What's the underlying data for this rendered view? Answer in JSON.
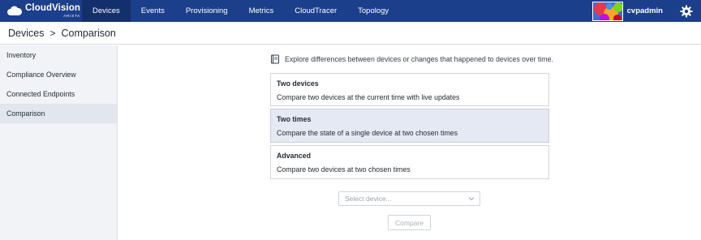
{
  "app": {
    "logo_title": "CloudVision",
    "logo_sub": "ARISTA"
  },
  "nav": {
    "tabs": [
      {
        "label": "Devices",
        "active": true
      },
      {
        "label": "Events",
        "active": false
      },
      {
        "label": "Provisioning",
        "active": false
      },
      {
        "label": "Metrics",
        "active": false
      },
      {
        "label": "CloudTracer",
        "active": false
      },
      {
        "label": "Topology",
        "active": false
      }
    ],
    "username": "cvpadmin",
    "settings_icon": "gear-icon"
  },
  "breadcrumb": {
    "parent": "Devices",
    "separator": ">",
    "current": "Comparison"
  },
  "sidebar": {
    "items": [
      {
        "label": "Inventory",
        "active": false
      },
      {
        "label": "Compliance Overview",
        "active": false
      },
      {
        "label": "Connected Endpoints",
        "active": false
      },
      {
        "label": "Comparison",
        "active": true
      }
    ]
  },
  "main": {
    "intro": "Explore differences between devices or changes that happened to devices over time.",
    "intro_icon": "book-icon",
    "options": [
      {
        "title": "Two devices",
        "description": "Compare two devices at the current time with live updates",
        "selected": false
      },
      {
        "title": "Two times",
        "description": "Compare the state of a single device at two chosen times",
        "selected": true
      },
      {
        "title": "Advanced",
        "description": "Compare two devices at two chosen times",
        "selected": false
      }
    ],
    "device_select": {
      "placeholder": "Select device..."
    },
    "compare_button": {
      "label": "Compare",
      "disabled": true
    }
  },
  "colors": {
    "nav_bg": "#1c3f8b",
    "nav_active": "#14306c",
    "sidebar_bg": "#f1f3f6",
    "selected_option": "#e4e9f4"
  }
}
